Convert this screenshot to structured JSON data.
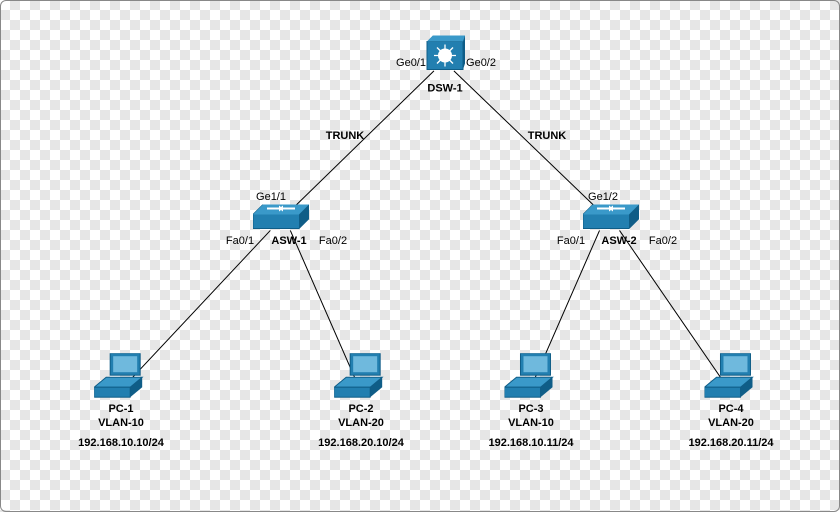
{
  "colors": {
    "cisco_blue": "#227fb0",
    "cisco_blue_dark": "#0f5d87"
  },
  "devices": {
    "dsw1": {
      "name": "DSW-1",
      "ports": {
        "left": "Ge0/1",
        "right": "Ge0/2"
      }
    },
    "asw1": {
      "name": "ASW-1",
      "ports": {
        "up": "Ge1/1",
        "left": "Fa0/1",
        "right": "Fa0/2"
      }
    },
    "asw2": {
      "name": "ASW-2",
      "ports": {
        "up": "Ge1/2",
        "left": "Fa0/1",
        "right": "Fa0/2"
      }
    }
  },
  "links": {
    "dsw_asw1": "TRUNK",
    "dsw_asw2": "TRUNK"
  },
  "pcs": {
    "pc1": {
      "name": "PC-1",
      "vlan": "VLAN-10",
      "ip": "192.168.10.10/24"
    },
    "pc2": {
      "name": "PC-2",
      "vlan": "VLAN-20",
      "ip": "192.168.20.10/24"
    },
    "pc3": {
      "name": "PC-3",
      "vlan": "VLAN-10",
      "ip": "192.168.10.11/24"
    },
    "pc4": {
      "name": "PC-4",
      "vlan": "VLAN-20",
      "ip": "192.168.20.11/24"
    }
  }
}
